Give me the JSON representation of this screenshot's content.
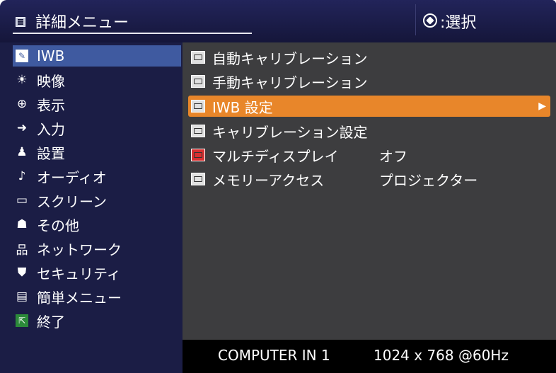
{
  "header": {
    "title": "詳細メニュー",
    "select_label": ":選択"
  },
  "left_menu": [
    {
      "label": "IWB",
      "icon": "iwb-icon"
    },
    {
      "label": "映像",
      "icon": "brightness-icon"
    },
    {
      "label": "表示",
      "icon": "display-icon"
    },
    {
      "label": "入力",
      "icon": "input-icon"
    },
    {
      "label": "設置",
      "icon": "setup-icon"
    },
    {
      "label": "オーディオ",
      "icon": "audio-note-icon"
    },
    {
      "label": "スクリーン",
      "icon": "screen-icon"
    },
    {
      "label": "その他",
      "icon": "other-icon"
    },
    {
      "label": "ネットワーク",
      "icon": "network-icon"
    },
    {
      "label": "セキュリティ",
      "icon": "security-shield-icon"
    },
    {
      "label": "簡単メニュー",
      "icon": "easy-menu-icon"
    },
    {
      "label": "終了",
      "icon": "exit-icon"
    }
  ],
  "right_menu": [
    {
      "label": "自動キャリブレーション",
      "value": ""
    },
    {
      "label": "手動キャリブレーション",
      "value": ""
    },
    {
      "label": "IWB 設定",
      "value": "",
      "arrow": "▶"
    },
    {
      "label": "キャリブレーション設定",
      "value": ""
    },
    {
      "label": "マルチディスプレイ",
      "value": "オフ"
    },
    {
      "label": "メモリーアクセス",
      "value": "プロジェクター"
    }
  ],
  "footer": {
    "source": "COMPUTER IN 1",
    "resolution": "1024 x 768 @60Hz"
  }
}
